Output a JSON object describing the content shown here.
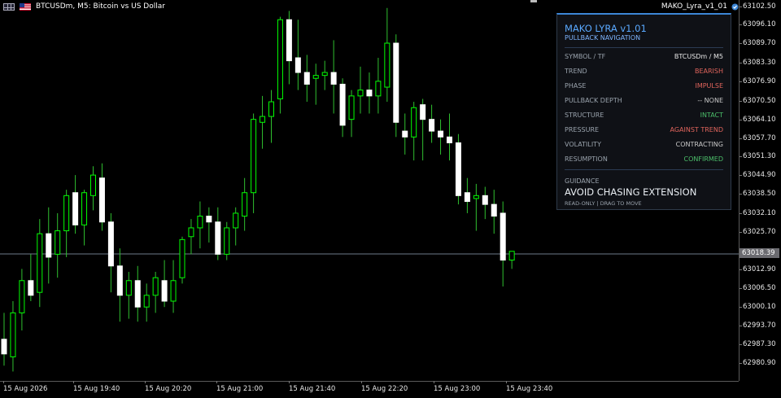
{
  "header": {
    "symbol_line": "BTCUSDm, M5:  Bitcoin vs US Dollar",
    "indicator_name": "MAKO_Lyra_v1_01"
  },
  "price_axis": {
    "ticks": [
      "63102.50",
      "63096.10",
      "63089.70",
      "63083.30",
      "63076.90",
      "63070.50",
      "63064.10",
      "63057.70",
      "63051.30",
      "63044.90",
      "63038.50",
      "63032.10",
      "63025.70",
      "63012.90",
      "63006.50",
      "63000.10",
      "62993.70",
      "62987.30",
      "62980.90"
    ],
    "current_price": "63018.39"
  },
  "time_axis": {
    "ticks": [
      "15 Aug 2026",
      "15 Aug 19:40",
      "15 Aug 20:20",
      "15 Aug 21:00",
      "15 Aug 21:40",
      "15 Aug 22:20",
      "15 Aug 23:00",
      "15 Aug 23:40"
    ]
  },
  "panel": {
    "title": "MAKO LYRA v1.01",
    "subtitle": "PULLBACK NAVIGATION",
    "rows": [
      {
        "label": "SYMBOL / TF",
        "value": "BTCUSDm / M5",
        "color": "#e6e6e6"
      },
      {
        "label": "TREND",
        "value": "BEARISH",
        "color": "#e0645c"
      },
      {
        "label": "PHASE",
        "value": "IMPULSE",
        "color": "#e0645c"
      },
      {
        "label": "PULLBACK DEPTH",
        "value": "--  NONE",
        "color": "#c8c8c8"
      },
      {
        "label": "STRUCTURE",
        "value": "INTACT",
        "color": "#4cbf6a"
      },
      {
        "label": "PRESSURE",
        "value": "AGAINST TREND",
        "color": "#e0645c"
      },
      {
        "label": "VOLATILITY",
        "value": "CONTRACTING",
        "color": "#c8c8c8"
      },
      {
        "label": "RESUMPTION",
        "value": "CONFIRMED",
        "color": "#4cbf6a"
      }
    ],
    "guidance_label": "GUIDANCE",
    "guidance_value": "AVOID CHASING EXTENSION",
    "guidance_sub": "READ-ONLY  |  DRAG TO MOVE"
  },
  "chart_data": {
    "type": "candlestick",
    "bull_color": "#00ff00",
    "bear_color": "#ffffff",
    "wick_color": "#2fbf2f",
    "candles": [
      {
        "o": 62989,
        "h": 62998,
        "l": 62980,
        "c": 62984
      },
      {
        "o": 62983,
        "h": 63002,
        "l": 62978,
        "c": 62998
      },
      {
        "o": 62998,
        "h": 63013,
        "l": 62992,
        "c": 63009
      },
      {
        "o": 63009,
        "h": 63018,
        "l": 63002,
        "c": 63004
      },
      {
        "o": 63005,
        "h": 63030,
        "l": 63000,
        "c": 63025
      },
      {
        "o": 63025,
        "h": 63034,
        "l": 63008,
        "c": 63017
      },
      {
        "o": 63018,
        "h": 63032,
        "l": 63010,
        "c": 63026
      },
      {
        "o": 63026,
        "h": 63040,
        "l": 63017,
        "c": 63038
      },
      {
        "o": 63039,
        "h": 63045,
        "l": 63025,
        "c": 63028
      },
      {
        "o": 63028,
        "h": 63040,
        "l": 63021,
        "c": 63039
      },
      {
        "o": 63038,
        "h": 63048,
        "l": 63033,
        "c": 63045
      },
      {
        "o": 63044,
        "h": 63049,
        "l": 63026,
        "c": 63029
      },
      {
        "o": 63029,
        "h": 63032,
        "l": 63005,
        "c": 63014
      },
      {
        "o": 63014,
        "h": 63020,
        "l": 62995,
        "c": 63004
      },
      {
        "o": 63004,
        "h": 63012,
        "l": 62996,
        "c": 63009
      },
      {
        "o": 63009,
        "h": 63014,
        "l": 62995,
        "c": 63000
      },
      {
        "o": 63000,
        "h": 63008,
        "l": 62995,
        "c": 63004
      },
      {
        "o": 63004,
        "h": 63012,
        "l": 62998,
        "c": 63010
      },
      {
        "o": 63009,
        "h": 63016,
        "l": 63000,
        "c": 63002
      },
      {
        "o": 63002,
        "h": 63016,
        "l": 62998,
        "c": 63009
      },
      {
        "o": 63010,
        "h": 63024,
        "l": 63008,
        "c": 63023
      },
      {
        "o": 63024,
        "h": 63030,
        "l": 63018,
        "c": 63027
      },
      {
        "o": 63027,
        "h": 63036,
        "l": 63020,
        "c": 63031
      },
      {
        "o": 63031,
        "h": 63034,
        "l": 63022,
        "c": 63029
      },
      {
        "o": 63029,
        "h": 63034,
        "l": 63016,
        "c": 63018
      },
      {
        "o": 63018,
        "h": 63029,
        "l": 63016,
        "c": 63027
      },
      {
        "o": 63027,
        "h": 63034,
        "l": 63021,
        "c": 63032
      },
      {
        "o": 63031,
        "h": 63044,
        "l": 63026,
        "c": 63039
      },
      {
        "o": 63039,
        "h": 63066,
        "l": 63032,
        "c": 63064
      },
      {
        "o": 63063,
        "h": 63072,
        "l": 63054,
        "c": 63065
      },
      {
        "o": 63065,
        "h": 63074,
        "l": 63056,
        "c": 63070
      },
      {
        "o": 63071,
        "h": 63099,
        "l": 63066,
        "c": 63098
      },
      {
        "o": 63098,
        "h": 63101,
        "l": 63076,
        "c": 63084
      },
      {
        "o": 63085,
        "h": 63098,
        "l": 63074,
        "c": 63080
      },
      {
        "o": 63080,
        "h": 63086,
        "l": 63070,
        "c": 63076
      },
      {
        "o": 63078,
        "h": 63083,
        "l": 63069,
        "c": 63079
      },
      {
        "o": 63079,
        "h": 63084,
        "l": 63074,
        "c": 63080
      },
      {
        "o": 63080,
        "h": 63091,
        "l": 63066,
        "c": 63076
      },
      {
        "o": 63076,
        "h": 63078,
        "l": 63058,
        "c": 63062
      },
      {
        "o": 63064,
        "h": 63074,
        "l": 63058,
        "c": 63072
      },
      {
        "o": 63072,
        "h": 63082,
        "l": 63066,
        "c": 63074
      },
      {
        "o": 63074,
        "h": 63080,
        "l": 63066,
        "c": 63072
      },
      {
        "o": 63072,
        "h": 63085,
        "l": 63066,
        "c": 63077
      },
      {
        "o": 63075,
        "h": 63102,
        "l": 63070,
        "c": 63090
      },
      {
        "o": 63090,
        "h": 63093,
        "l": 63058,
        "c": 63063
      },
      {
        "o": 63060,
        "h": 63066,
        "l": 63052,
        "c": 63058
      },
      {
        "o": 63058,
        "h": 63070,
        "l": 63050,
        "c": 63068
      },
      {
        "o": 63069,
        "h": 63071,
        "l": 63050,
        "c": 63064
      },
      {
        "o": 63064,
        "h": 63069,
        "l": 63056,
        "c": 63060
      },
      {
        "o": 63060,
        "h": 63064,
        "l": 63052,
        "c": 63058
      },
      {
        "o": 63058,
        "h": 63066,
        "l": 63050,
        "c": 63056
      },
      {
        "o": 63056,
        "h": 63059,
        "l": 63035,
        "c": 63038
      },
      {
        "o": 63039,
        "h": 63044,
        "l": 63032,
        "c": 63036
      },
      {
        "o": 63037,
        "h": 63042,
        "l": 63026,
        "c": 63038
      },
      {
        "o": 63038,
        "h": 63041,
        "l": 63030,
        "c": 63035
      },
      {
        "o": 63035,
        "h": 63040,
        "l": 63025,
        "c": 63031
      },
      {
        "o": 63032,
        "h": 63036,
        "l": 63007,
        "c": 63016
      },
      {
        "o": 63016,
        "h": 63019,
        "l": 63013,
        "c": 63019
      }
    ]
  }
}
